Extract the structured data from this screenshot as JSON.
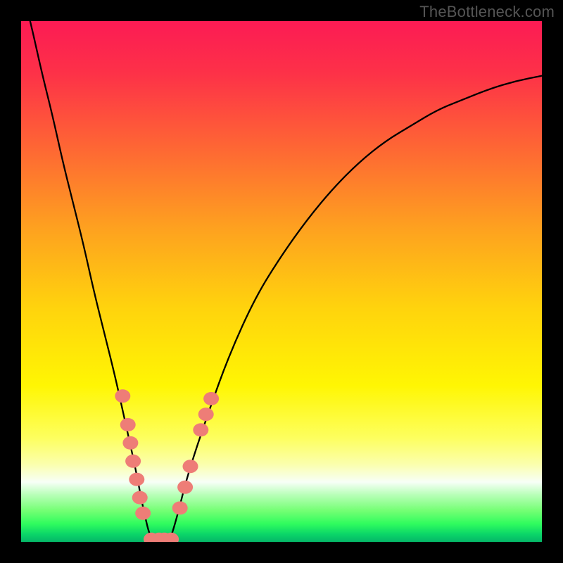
{
  "watermark": "TheBottleneck.com",
  "chart_data": {
    "type": "line",
    "title": "",
    "xlabel": "",
    "ylabel": "",
    "xlim": [
      0,
      100
    ],
    "ylim": [
      0,
      100
    ],
    "series": [
      {
        "name": "bottleneck-curve",
        "x": [
          0,
          2,
          4,
          6,
          8,
          10,
          12,
          14,
          16,
          18,
          20,
          22,
          23.5,
          25,
          27,
          28.5,
          30,
          32,
          36,
          40,
          45,
          50,
          55,
          60,
          65,
          70,
          75,
          80,
          85,
          90,
          95,
          100
        ],
        "y": [
          107,
          99,
          90,
          82,
          73,
          65,
          57,
          48,
          40,
          32,
          23,
          14,
          6,
          0,
          0,
          0,
          5,
          13,
          25,
          36,
          47,
          55,
          62,
          68,
          73,
          77,
          80,
          83,
          85,
          87,
          88.5,
          89.5
        ]
      }
    ],
    "markers": [
      {
        "x": 19.5,
        "y": 28.0
      },
      {
        "x": 20.5,
        "y": 22.5
      },
      {
        "x": 21.0,
        "y": 19.0
      },
      {
        "x": 21.5,
        "y": 15.5
      },
      {
        "x": 22.2,
        "y": 12.0
      },
      {
        "x": 22.8,
        "y": 8.5
      },
      {
        "x": 23.4,
        "y": 5.5
      },
      {
        "x": 25.0,
        "y": 0.5
      },
      {
        "x": 26.5,
        "y": 0.5
      },
      {
        "x": 27.5,
        "y": 0.5
      },
      {
        "x": 28.8,
        "y": 0.5
      },
      {
        "x": 30.5,
        "y": 6.5
      },
      {
        "x": 31.5,
        "y": 10.5
      },
      {
        "x": 32.5,
        "y": 14.5
      },
      {
        "x": 34.5,
        "y": 21.5
      },
      {
        "x": 35.5,
        "y": 24.5
      },
      {
        "x": 36.5,
        "y": 27.5
      }
    ],
    "gradient_stops": [
      {
        "offset": 0.0,
        "color": "#fc1b54"
      },
      {
        "offset": 0.1,
        "color": "#fd3148"
      },
      {
        "offset": 0.25,
        "color": "#fe6933"
      },
      {
        "offset": 0.4,
        "color": "#fea21f"
      },
      {
        "offset": 0.55,
        "color": "#ffd30d"
      },
      {
        "offset": 0.7,
        "color": "#fff603"
      },
      {
        "offset": 0.8,
        "color": "#fdff5e"
      },
      {
        "offset": 0.85,
        "color": "#fbffab"
      },
      {
        "offset": 0.885,
        "color": "#f7fff7"
      },
      {
        "offset": 0.91,
        "color": "#b7ffb7"
      },
      {
        "offset": 0.94,
        "color": "#74ff74"
      },
      {
        "offset": 0.965,
        "color": "#30fc5e"
      },
      {
        "offset": 0.985,
        "color": "#0bd668"
      },
      {
        "offset": 1.0,
        "color": "#05b668"
      }
    ],
    "marker_color": "#ee7d77"
  }
}
